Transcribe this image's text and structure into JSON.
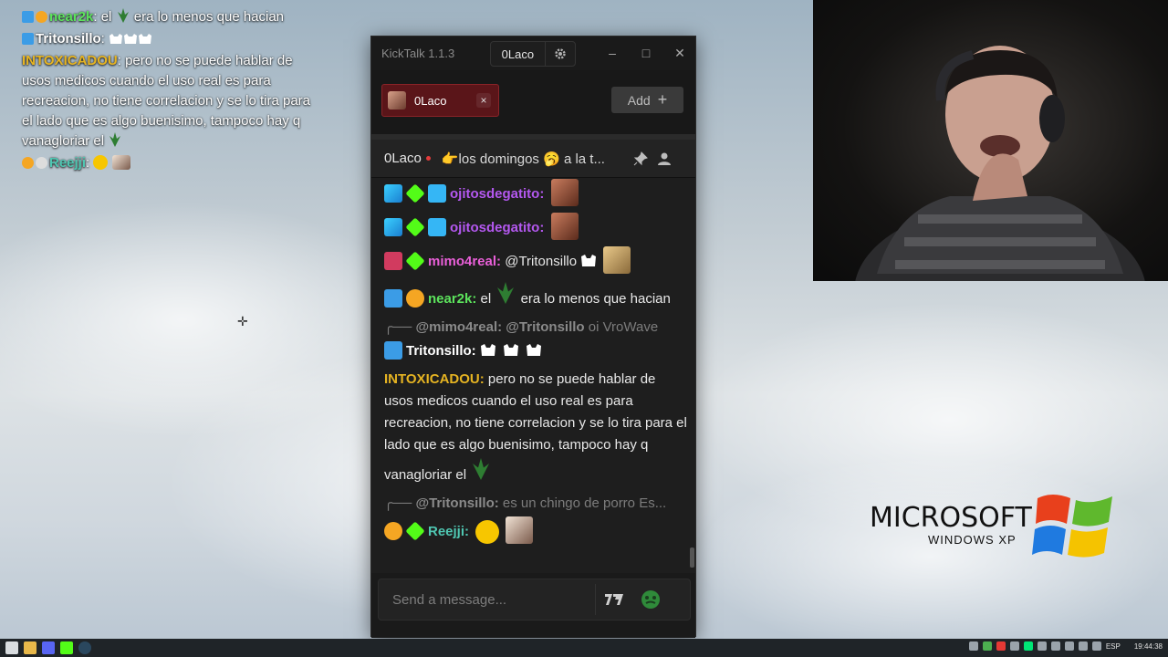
{
  "overlay_chat": {
    "lines": [
      {
        "user": "near2k",
        "text": "el",
        "text_after": "era lo menos que hacian"
      },
      {
        "user": "Tritonsillo",
        "text": ""
      },
      {
        "user": "INTOXICADOU",
        "text": "pero no se puede hablar de usos medicos cuando el uso real es para recreacion, no tiene correlacion y se lo tira para el lado que es algo buenisimo, tampoco hay q vanagloriar el"
      },
      {
        "user": "Reejji",
        "text": ""
      }
    ]
  },
  "app": {
    "title": "KickTalk 1.1.3",
    "current_user": "0Laco",
    "window_buttons": {
      "minimize": "–",
      "maximize": "□",
      "close": "✕"
    }
  },
  "tabs": [
    {
      "label": "0Laco",
      "close": "×"
    }
  ],
  "add_button": {
    "label": "Add",
    "icon": "+"
  },
  "channel": {
    "name": "0Laco",
    "pinned_message": "👉los domingos 🥱 a la t..."
  },
  "messages": [
    {
      "user": "ojitosdegatito",
      "text": ""
    },
    {
      "user": "ojitosdegatito",
      "text": ""
    },
    {
      "user": "mimo4real",
      "text": "@Tritonsillo"
    },
    {
      "user": "near2k",
      "text": "el",
      "text_after": "era lo menos que hacian"
    },
    {
      "reply_to": "@mimo4real: @Tritonsillo",
      "reply_text": "oi VroWave"
    },
    {
      "user": "Tritonsillo",
      "text": ""
    },
    {
      "user": "INTOXICADOU",
      "text": "pero no se puede hablar de usos medicos cuando el uso real es para recreacion, no tiene correlacion y se lo tira para el lado que es algo buenisimo, tampoco hay q vanagloriar el"
    },
    {
      "reply_to": "@Tritonsillo:",
      "reply_text": "es un chingo de porro Es..."
    },
    {
      "user": "Reejji",
      "text": ""
    }
  ],
  "input": {
    "placeholder": "Send a message..."
  },
  "xp_logo": {
    "brand": "MICROSOFT",
    "product": "WINDOWS XP"
  },
  "taskbar": {
    "lang": "ESP",
    "time": "19:44:38"
  },
  "colors": {
    "ojitos": "#b458f0",
    "mimo": "#e95fd8",
    "near2k": "#5ce35c",
    "tritonsillo": "#ffffff",
    "intox": "#e6b422",
    "reejji": "#4fc7b2",
    "tab_bg": "#5a1519",
    "live_dot": "#e23b3b"
  }
}
